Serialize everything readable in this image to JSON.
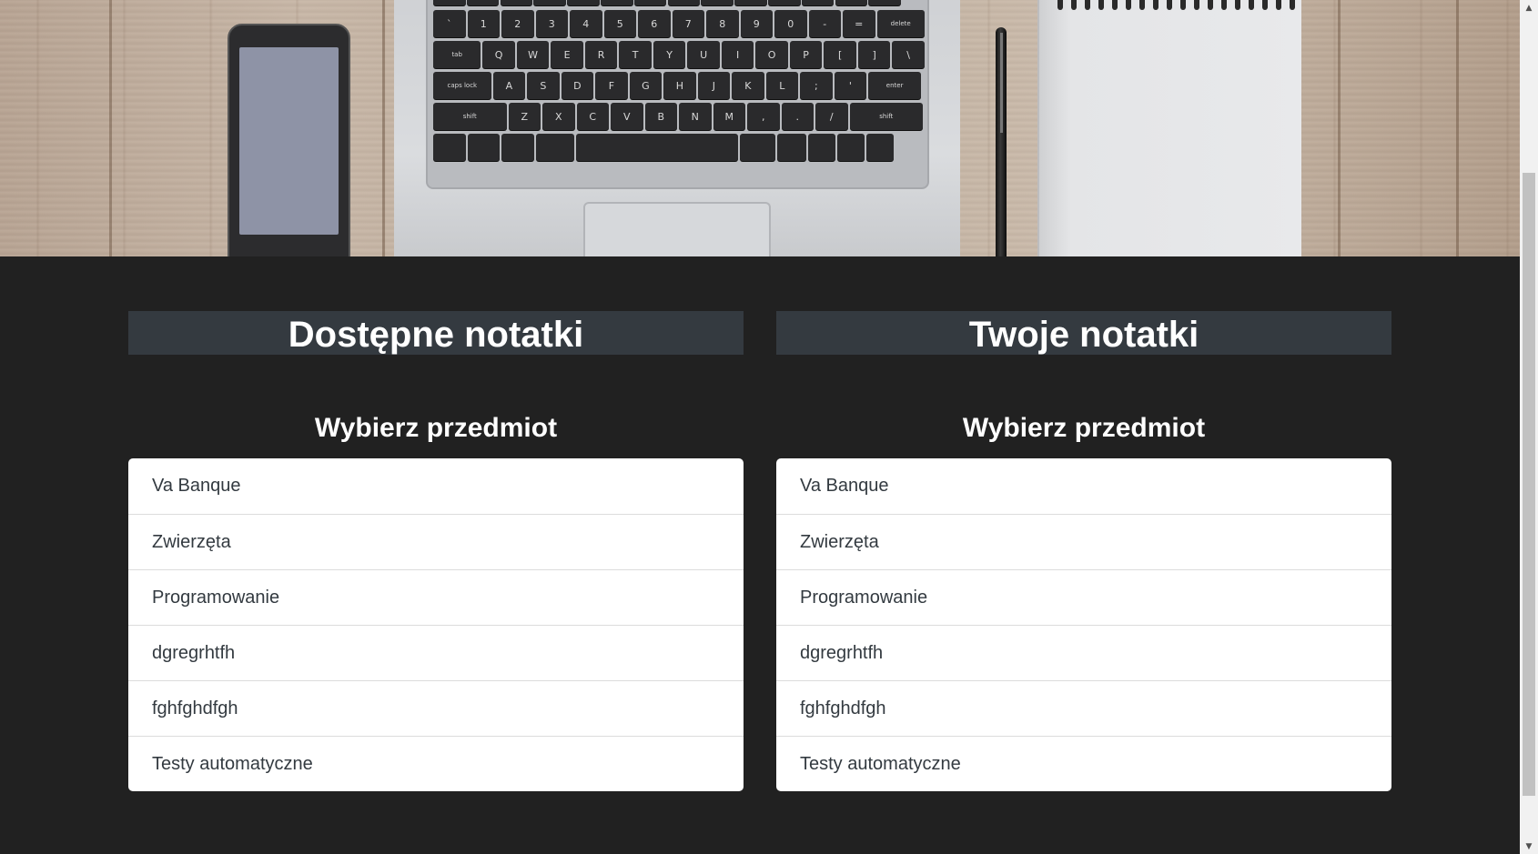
{
  "hero": {
    "keys_row1": [
      "~`",
      "!1",
      "@2",
      "#3",
      "$4",
      "%5",
      "^6",
      "&7",
      "*8",
      "(9",
      ")0",
      "_-",
      "+=",
      "delete"
    ],
    "keys_row2": [
      "tab",
      "Q",
      "W",
      "E",
      "R",
      "T",
      "Y",
      "U",
      "I",
      "O",
      "P",
      "{[",
      "}]",
      "|\\"
    ],
    "keys_row3": [
      "caps lock",
      "A",
      "S",
      "D",
      "F",
      "G",
      "H",
      "J",
      "K",
      "L",
      ":;",
      "\"'",
      "enter"
    ],
    "keys_row4": [
      "shift",
      "Z",
      "X",
      "C",
      "V",
      "B",
      "N",
      "M",
      "<,",
      ">.",
      "?/",
      "shift"
    ]
  },
  "left_panel": {
    "title": "Dostępne notatki",
    "subtitle": "Wybierz przedmiot",
    "subjects": [
      "Va Banque",
      "Zwierzęta",
      "Programowanie",
      "dgregrhtfh",
      "fghfghdfgh",
      "Testy automatyczne"
    ]
  },
  "right_panel": {
    "title": "Twoje notatki",
    "subtitle": "Wybierz przedmiot",
    "subjects": [
      "Va Banque",
      "Zwierzęta",
      "Programowanie",
      "dgregrhtfh",
      "fghfghdfgh",
      "Testy automatyczne"
    ]
  },
  "colors": {
    "page_background": "#212121",
    "title_bar": "#343a40",
    "list_background": "#ffffff",
    "list_text": "#333a40"
  }
}
